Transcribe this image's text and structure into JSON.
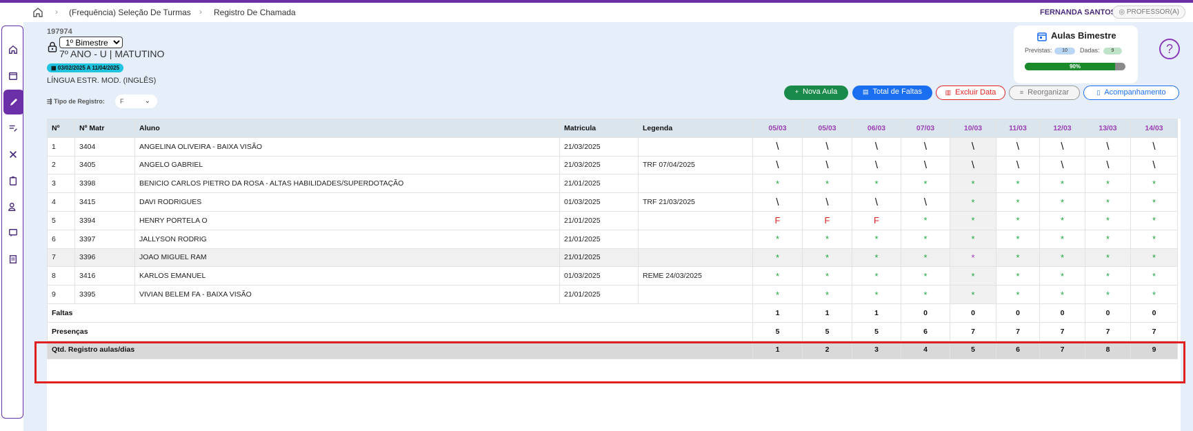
{
  "nav": {
    "breadcrumbs": [
      "(Frequência) Seleção De Turmas",
      "Registro De Chamada"
    ],
    "user_name": "FERNANDA SANTOS",
    "role": "PROFESSOR(A)"
  },
  "class": {
    "code": "197974",
    "bimester": "1º Bimestre",
    "bimester_options": [
      "1º Bimestre"
    ],
    "name": "7º ANO - U | MATUTINO",
    "date_range": "03/02/2025 A 11/04/2025",
    "subject": "LÍNGUA ESTR. MOD. (INGLÊS)"
  },
  "register_type": {
    "label": "Tipo de Registro:",
    "value": "F"
  },
  "summary": {
    "title": "Aulas Bimestre",
    "previstas_label": "Previstas:",
    "previstas": "10",
    "dadas_label": "Dadas:",
    "dadas": "9",
    "progress_label": "90%",
    "progress": 0.9
  },
  "actions": {
    "nova_aula": "Nova Aula",
    "total_faltas": "Total de Faltas",
    "excluir_data": "Excluir Data",
    "reorganizar": "Reorganizar",
    "acompanhamento": "Acompanhamento"
  },
  "table": {
    "headers": {
      "n": "Nº",
      "matr": "Nº Matr",
      "aluno": "Aluno",
      "matricula": "Matricula",
      "legenda": "Legenda"
    },
    "dates": [
      "05/03",
      "05/03",
      "06/03",
      "07/03",
      "10/03",
      "11/03",
      "12/03",
      "13/03",
      "14/03"
    ],
    "students": [
      {
        "n": "1",
        "matr": "3404",
        "aluno": "ANGELINA OLIVEIRA - BAIXA VISÃO",
        "matricula": "21/03/2025",
        "legenda": "",
        "marks": [
          "\\",
          "\\",
          "\\",
          "\\",
          "\\",
          "\\",
          "\\",
          "\\",
          "\\"
        ]
      },
      {
        "n": "2",
        "matr": "3405",
        "aluno": "ANGELO GABRIEL",
        "matricula": "21/03/2025",
        "legenda": "TRF 07/04/2025",
        "marks": [
          "\\",
          "\\",
          "\\",
          "\\",
          "\\",
          "\\",
          "\\",
          "\\",
          "\\"
        ]
      },
      {
        "n": "3",
        "matr": "3398",
        "aluno": "BENICIO CARLOS PIETRO DA ROSA - ALTAS HABILIDADES/SUPERDOTAÇÃO",
        "matricula": "21/01/2025",
        "legenda": "",
        "marks": [
          "*",
          "*",
          "*",
          "*",
          "*",
          "*",
          "*",
          "*",
          "*"
        ]
      },
      {
        "n": "4",
        "matr": "3415",
        "aluno": "DAVI RODRIGUES",
        "matricula": "01/03/2025",
        "legenda": "TRF 21/03/2025",
        "marks": [
          "\\",
          "\\",
          "\\",
          "\\",
          "*",
          "*",
          "*",
          "*",
          "*"
        ]
      },
      {
        "n": "5",
        "matr": "3394",
        "aluno": "HENRY PORTELA O",
        "matricula": "21/01/2025",
        "legenda": "",
        "marks": [
          "F",
          "F",
          "F",
          "*",
          "*",
          "*",
          "*",
          "*",
          "*"
        ]
      },
      {
        "n": "6",
        "matr": "3397",
        "aluno": "JALLYSON RODRIG",
        "matricula": "21/01/2025",
        "legenda": "",
        "marks": [
          "*",
          "*",
          "*",
          "*",
          "*",
          "*",
          "*",
          "*",
          "*"
        ]
      },
      {
        "n": "7",
        "matr": "3396",
        "aluno": "JOAO MIGUEL RAM",
        "matricula": "21/01/2025",
        "legenda": "",
        "marks": [
          "*",
          "*",
          "*",
          "*",
          "p*",
          "*",
          "*",
          "*",
          "*"
        ]
      },
      {
        "n": "8",
        "matr": "3416",
        "aluno": "KARLOS EMANUEL",
        "matricula": "01/03/2025",
        "legenda": "REME 24/03/2025",
        "marks": [
          "*",
          "*",
          "*",
          "*",
          "*",
          "*",
          "*",
          "*",
          "*"
        ]
      },
      {
        "n": "9",
        "matr": "3395",
        "aluno": "VIVIAN BELEM FA - BAIXA VISÃO",
        "matricula": "21/01/2025",
        "legenda": "",
        "marks": [
          "*",
          "*",
          "*",
          "*",
          "*",
          "*",
          "*",
          "*",
          "*"
        ]
      }
    ],
    "faltas_label": "Faltas",
    "faltas": [
      "1",
      "1",
      "1",
      "0",
      "0",
      "0",
      "0",
      "0",
      "0"
    ],
    "presencas_label": "Presenças",
    "presencas": [
      "5",
      "5",
      "5",
      "6",
      "7",
      "7",
      "7",
      "7",
      "7"
    ],
    "qtd_label": "Qtd. Registro aulas/dias",
    "qtd": [
      "1",
      "2",
      "3",
      "4",
      "5",
      "6",
      "7",
      "8",
      "9"
    ]
  },
  "colors": {
    "brand": "#6b2fa8",
    "green": "#1a8a2a",
    "blue": "#1a6ef0",
    "red": "#e02020",
    "date_header": "#9b3fb5"
  }
}
